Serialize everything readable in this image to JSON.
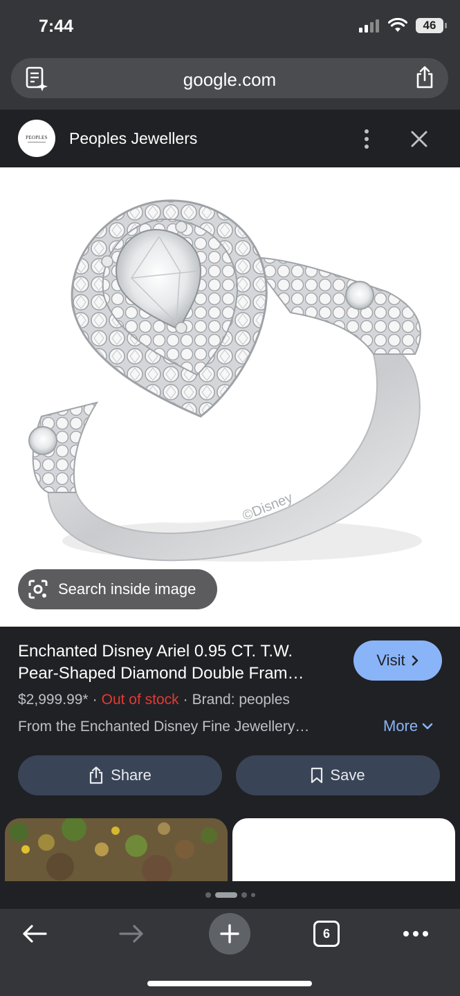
{
  "status_bar": {
    "time": "7:44",
    "battery": "46"
  },
  "url_bar": {
    "url": "google.com"
  },
  "site": {
    "name": "Peoples Jewellers",
    "logo_text": "PEOPLES"
  },
  "image": {
    "engraving": "©Disney",
    "lens_label": "Search inside image"
  },
  "product": {
    "title": "Enchanted Disney Ariel 0.95 CT. T.W. Pear-Shaped Diamond Double Fram…",
    "visit_label": "Visit",
    "price": "$2,999.99*",
    "stock": "Out of stock",
    "brand": "Brand: peoples",
    "separator": "·",
    "description": "From the Enchanted Disney Fine Jewellery…",
    "more_label": "More",
    "share_label": "Share",
    "save_label": "Save"
  },
  "pager": {
    "active_index": 1,
    "count": 4
  },
  "toolbar": {
    "tab_count": "6"
  },
  "colors": {
    "accent": "#8ab4f8",
    "out_of_stock": "#e53935",
    "action_button": "#394457",
    "background": "#202124"
  }
}
